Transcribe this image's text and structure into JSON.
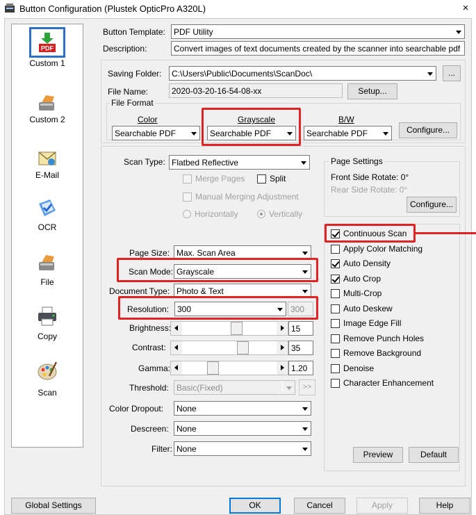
{
  "window": {
    "title": "Button Configuration (Plustek OpticPro A320L)",
    "close": "×"
  },
  "sidebar": {
    "items": [
      {
        "label": "Custom 1",
        "icon": "pdf-icon",
        "badge": "PDF"
      },
      {
        "label": "Custom 2",
        "icon": "scanner-icon"
      },
      {
        "label": "E-Mail",
        "icon": "email-icon"
      },
      {
        "label": "OCR",
        "icon": "ocr-icon"
      },
      {
        "label": "File",
        "icon": "file-scanner-icon"
      },
      {
        "label": "Copy",
        "icon": "printer-icon"
      },
      {
        "label": "Scan",
        "icon": "palette-icon"
      }
    ]
  },
  "template": {
    "button_template_label": "Button Template:",
    "button_template_value": "PDF Utility",
    "description_label": "Description:",
    "description_value": "Convert images of text documents created by the scanner into searchable pdf or p"
  },
  "saving": {
    "folder_label": "Saving Folder:",
    "folder_value": "C:\\Users\\Public\\Documents\\ScanDoc\\",
    "browse": "...",
    "filename_label": "File Name:",
    "filename_value": "2020-03-20-16-54-08-xx",
    "setup": "Setup..."
  },
  "file_format": {
    "title": "File Format",
    "color_label": "Color",
    "color_value": "Searchable PDF",
    "gray_label": "Grayscale",
    "gray_value": "Searchable PDF",
    "bw_label": "B/W",
    "bw_value": "Searchable PDF",
    "configure": "Configure..."
  },
  "scan": {
    "scan_type_label": "Scan Type:",
    "scan_type_value": "Flatbed Reflective",
    "merge_pages": "Merge Pages",
    "split": "Split",
    "manual_merging": "Manual Merging Adjustment",
    "horizontally": "Horizontally",
    "vertically": "Vertically",
    "page_size_label": "Page Size:",
    "page_size_value": "Max. Scan Area",
    "scan_mode_label": "Scan Mode:",
    "scan_mode_value": "Grayscale",
    "doc_type_label": "Document Type:",
    "doc_type_value": "Photo & Text",
    "resolution_label": "Resolution:",
    "resolution_value": "300",
    "resolution_custom": "300",
    "brightness_label": "Brightness:",
    "brightness_value": "15",
    "contrast_label": "Contrast:",
    "contrast_value": "35",
    "gamma_label": "Gamma:",
    "gamma_value": "1.20",
    "threshold_label": "Threshold:",
    "threshold_value": "Basic(Fixed)",
    "threshold_more": ">>",
    "color_dropout_label": "Color Dropout:",
    "color_dropout_value": "None",
    "descreen_label": "Descreen:",
    "descreen_value": "None",
    "filter_label": "Filter:",
    "filter_value": "None"
  },
  "page_settings": {
    "title": "Page Settings",
    "front_rotate": "Front Side Rotate: 0°",
    "rear_rotate": "Rear Side Rotate: 0°",
    "configure": "Configure..."
  },
  "options": {
    "items": [
      {
        "label": "Continuous Scan",
        "checked": true
      },
      {
        "label": "Apply Color Matching",
        "checked": false
      },
      {
        "label": "Auto Density",
        "checked": true
      },
      {
        "label": "Auto Crop",
        "checked": true
      },
      {
        "label": "Multi-Crop",
        "checked": false
      },
      {
        "label": "Auto Deskew",
        "checked": false
      },
      {
        "label": "Image Edge Fill",
        "checked": false
      },
      {
        "label": "Remove Punch Holes",
        "checked": false
      },
      {
        "label": "Remove Background",
        "checked": false
      },
      {
        "label": "Denoise",
        "checked": false
      },
      {
        "label": "Character Enhancement",
        "checked": false
      }
    ],
    "preview": "Preview",
    "default": "Default"
  },
  "footer": {
    "global_settings": "Global Settings",
    "ok": "OK",
    "cancel": "Cancel",
    "apply": "Apply",
    "help": "Help"
  },
  "colors": {
    "highlight": "#e02424",
    "selection": "#2b6fc7",
    "dialog_bg": "#f0f0f0"
  }
}
